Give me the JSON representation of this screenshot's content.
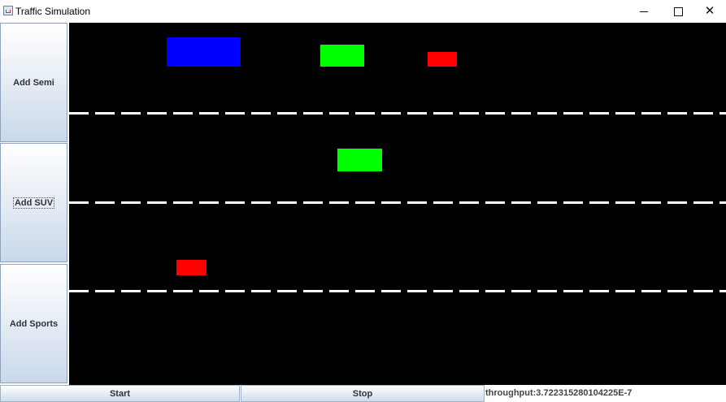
{
  "window": {
    "title": "Traffic Simulation",
    "controls": [
      "minimize",
      "maximize",
      "close"
    ],
    "close_glyph": "✕"
  },
  "sidebar": {
    "buttons": [
      {
        "label": "Add Semi"
      },
      {
        "label": "Add SUV"
      },
      {
        "label": "Add Sports"
      }
    ]
  },
  "road": {
    "background": "#000000",
    "lane_line_color": "#ffffff",
    "vehicles": [
      {
        "type": "Semi",
        "color": "#0000ff"
      },
      {
        "type": "SUV",
        "color": "#00ff00"
      },
      {
        "type": "Sports",
        "color": "#ff0000"
      },
      {
        "type": "SUV",
        "color": "#00ff00"
      },
      {
        "type": "Sports",
        "color": "#ff0000"
      }
    ]
  },
  "controls": {
    "start_label": "Start",
    "stop_label": "Stop"
  },
  "status": {
    "throughput": "throughput:3.722315280104225E-7"
  }
}
